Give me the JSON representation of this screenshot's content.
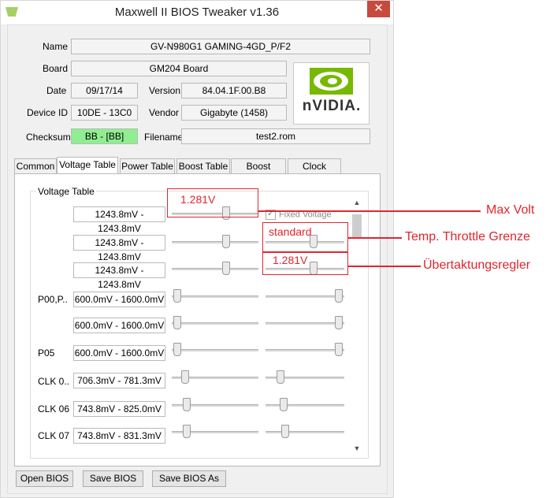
{
  "window": {
    "title": "Maxwell II BIOS Tweaker v1.36",
    "close_glyph": "✕"
  },
  "info": {
    "name_label": "Name",
    "name_value": "GV-N980G1 GAMING-4GD_P/F2",
    "board_label": "Board",
    "board_value": "GM204 Board",
    "date_label": "Date",
    "date_value": "09/17/14",
    "version_label": "Version",
    "version_value": "84.04.1F.00.B8",
    "device_label": "Device ID",
    "device_value": "10DE - 13C0",
    "vendor_label": "Vendor",
    "vendor_value": "Gigabyte (1458)",
    "checksum_label": "Checksum",
    "checksum_value": "BB - [BB]",
    "filename_label": "Filename",
    "filename_value": "test2.rom",
    "logo_text": "nVIDIA."
  },
  "tabs": [
    "Common",
    "Voltage Table",
    "Power Table",
    "Boost Table",
    "Boost States",
    "Clock States"
  ],
  "voltage": {
    "group_title": "Voltage Table",
    "fixed_voltage_label": "Fixed Voltage",
    "rows": [
      {
        "label": "",
        "value": "1243.8mV - 1243.8mV"
      },
      {
        "label": "",
        "value": "1243.8mV - 1243.8mV"
      },
      {
        "label": "",
        "value": "1243.8mV - 1243.8mV"
      },
      {
        "label": "P00,P..",
        "value": "600.0mV - 1600.0mV"
      },
      {
        "label": "",
        "value": "600.0mV - 1600.0mV"
      },
      {
        "label": "P05",
        "value": "600.0mV - 1600.0mV"
      },
      {
        "label": "CLK 0..",
        "value": "706.3mV - 781.3mV"
      },
      {
        "label": "CLK 06",
        "value": "743.8mV - 825.0mV"
      },
      {
        "label": "CLK 07",
        "value": "743.8mV - 831.3mV"
      }
    ]
  },
  "buttons": {
    "open": "Open BIOS",
    "save": "Save BIOS",
    "save_as": "Save BIOS As"
  },
  "annotations": {
    "box1_value": "1.281V",
    "box2_value": "standard",
    "box2_value2": "1.281V",
    "label_max": "Max Volt",
    "label_throttle": "Temp. Throttle Grenze",
    "label_oc": "Übertaktungsregler"
  },
  "colors": {
    "accent_red": "#e0262e",
    "checksum_green": "#90ee90",
    "close_red": "#c74a3f"
  }
}
